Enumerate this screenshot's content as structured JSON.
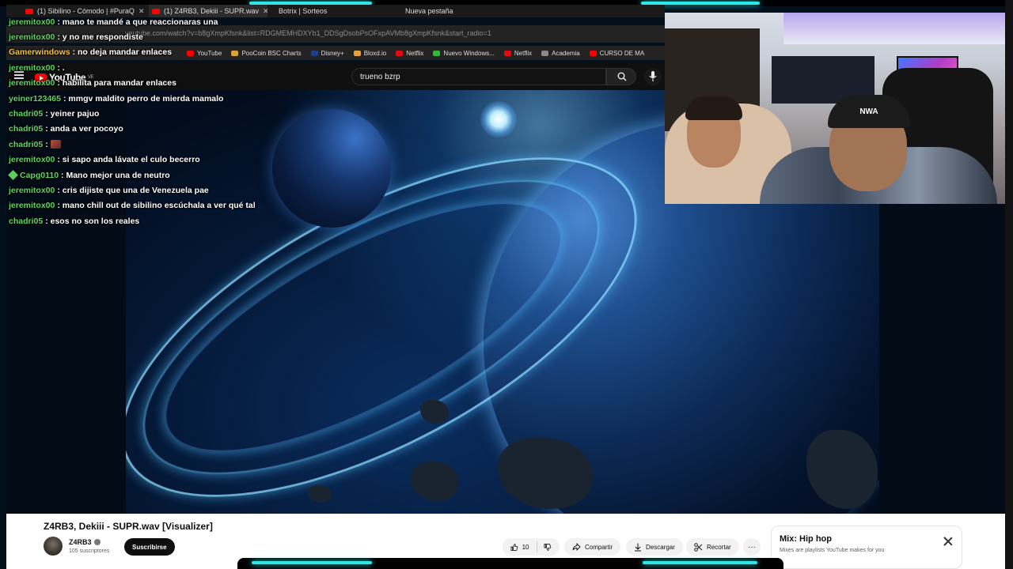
{
  "browser": {
    "tabs": [
      {
        "label": "(1) Sibilino - Cómodo | #PuraQ"
      },
      {
        "label": "(1) Z4RB3, Dekiii - SUPR.wav"
      },
      {
        "label": "Botrix | Sorteos"
      },
      {
        "label": "Nueva pestaña"
      }
    ],
    "url": "youtube.com/watch?v=b8gXmpKfsnk&list=RDGMEMHDXYb1_DDSgDsobPsOFxpAVMb8gXmpKfsnk&start_radio=1",
    "bookmarks": [
      "YouTube",
      "PooCoin BSC Charts",
      "Disney+",
      "Bloxd.io",
      "Netflix",
      "Nuevo Windows...",
      "Netflix",
      "Academia",
      "CURSO DE MA"
    ]
  },
  "youtube": {
    "logo": "YouTube",
    "region": "VE",
    "search_value": "trueno bzrp"
  },
  "video": {
    "title": "Z4RB3, Dekiii - SUPR.wav [Visualizer]",
    "channel": "Z4RB3",
    "subscribers": "105 suscriptores",
    "subscribe_label": "Suscribirse",
    "likes": "10",
    "share_label": "Compartir",
    "download_label": "Descargar",
    "clip_label": "Recortar",
    "more_label": "···"
  },
  "mix": {
    "title": "Mix: Hip hop",
    "subtitle": "Mixes are playlists YouTube makes for you"
  },
  "webcam": {
    "cap_text": "NWA"
  },
  "chat": [
    {
      "user": "jeremitox00",
      "color": "#5fd35f",
      "text": ": mano te mandé a que reaccionaras una"
    },
    {
      "user": "jeremitox00",
      "color": "#5fd35f",
      "text": ": y no me respondiste"
    },
    {
      "user": "Gamerwindows",
      "color": "#f2c433",
      "text": ": no deja mandar enlaces"
    },
    {
      "user": "jeremitox00",
      "color": "#5fd35f",
      "text": ": ."
    },
    {
      "user": "jeremitox00",
      "color": "#5fd35f",
      "text": ": habilita para mandar enlaces"
    },
    {
      "user": "yeiner123465",
      "color": "#5fd35f",
      "text": ": mmgv maldito perro de mierda mamalo"
    },
    {
      "user": "chadri05",
      "color": "#5fd35f",
      "text": ": yeiner pajuo"
    },
    {
      "user": "chadri05",
      "color": "#5fd35f",
      "text": ": anda a ver pocoyo"
    },
    {
      "user": "chadri05",
      "color": "#5fd35f",
      "text": ":"
    },
    {
      "user": "jeremitox00",
      "color": "#5fd35f",
      "text": ": si sapo anda lávate el culo becerro"
    },
    {
      "user": "Capg0110",
      "color": "#5fd35f",
      "text": ": Mano mejor una de neutro"
    },
    {
      "user": "jeremitox00",
      "color": "#5fd35f",
      "text": ": cris dijiste que una de Venezuela pae"
    },
    {
      "user": "jeremitox00",
      "color": "#5fd35f",
      "text": ": mano chill out de sibilino escúchala a ver qué tal"
    },
    {
      "user": "chadri05",
      "color": "#5fd35f",
      "text": ": esos no son los reales"
    }
  ],
  "colors": {
    "accent_glow": "#2fe6e6",
    "youtube_red": "#ff0000"
  }
}
